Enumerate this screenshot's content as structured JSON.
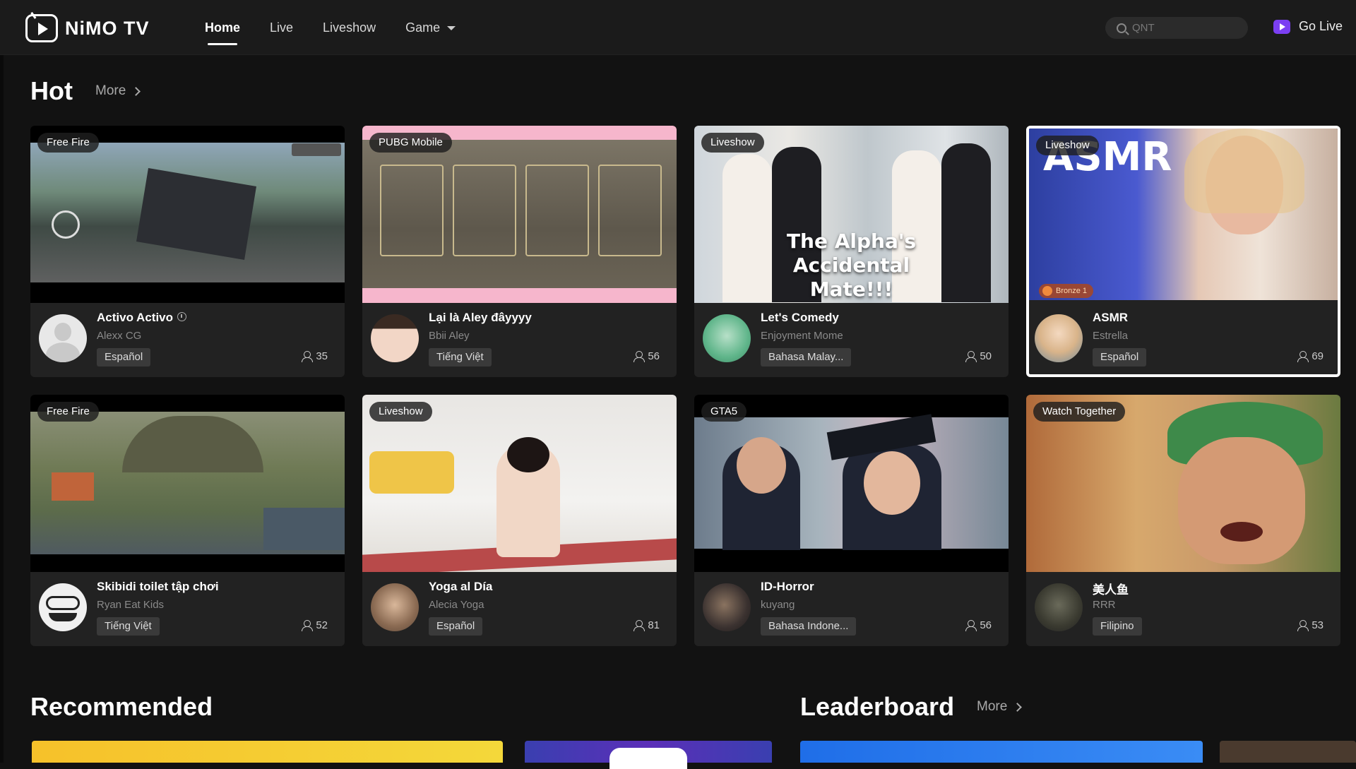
{
  "header": {
    "logo_text": "NiMO TV",
    "nav": [
      {
        "label": "Home",
        "active": true
      },
      {
        "label": "Live",
        "active": false
      },
      {
        "label": "Liveshow",
        "active": false
      },
      {
        "label": "Game",
        "active": false
      }
    ],
    "search_placeholder": "QNT",
    "go_live_label": "Go Live"
  },
  "hot": {
    "title": "Hot",
    "more_label": "More",
    "cards": [
      {
        "tag": "Free Fire",
        "title": "Activo Activo",
        "streamer": "Alexx CG",
        "language": "Español",
        "viewers": "35",
        "verified": true
      },
      {
        "tag": "PUBG Mobile",
        "title": "Lại là Aley đâyyyy",
        "streamer": "Bbii Aley",
        "language": "Tiếng Việt",
        "viewers": "56"
      },
      {
        "tag": "Liveshow",
        "title": "Let's Comedy",
        "streamer": "Enjoyment Mome",
        "language": "Bahasa Malay...",
        "viewers": "50",
        "overlay": "The Alpha's Accidental Mate!!!"
      },
      {
        "tag": "Liveshow",
        "title": "ASMR",
        "streamer": "Estrella",
        "language": "Español",
        "viewers": "69",
        "overlay": "ASMR",
        "badge": "Bronze 1"
      },
      {
        "tag": "Free Fire",
        "title": "Skibidi toilet tập chơi",
        "streamer": "Ryan Eat Kids",
        "language": "Tiếng Việt",
        "viewers": "52"
      },
      {
        "tag": "Liveshow",
        "title": "Yoga al Día",
        "streamer": "Alecia Yoga",
        "language": "Español",
        "viewers": "81"
      },
      {
        "tag": "GTA5",
        "title": "ID-Horror",
        "streamer": "kuyang",
        "language": "Bahasa Indone...",
        "viewers": "56"
      },
      {
        "tag": "Watch Together",
        "title": "美人鱼",
        "streamer": "RRR",
        "language": "Filipino",
        "viewers": "53"
      }
    ]
  },
  "recommended": {
    "title": "Recommended"
  },
  "leaderboard": {
    "title": "Leaderboard",
    "more_label": "More"
  },
  "colors": {
    "background": "#121212",
    "card": "#222222",
    "accent": "#7b3ff2"
  }
}
